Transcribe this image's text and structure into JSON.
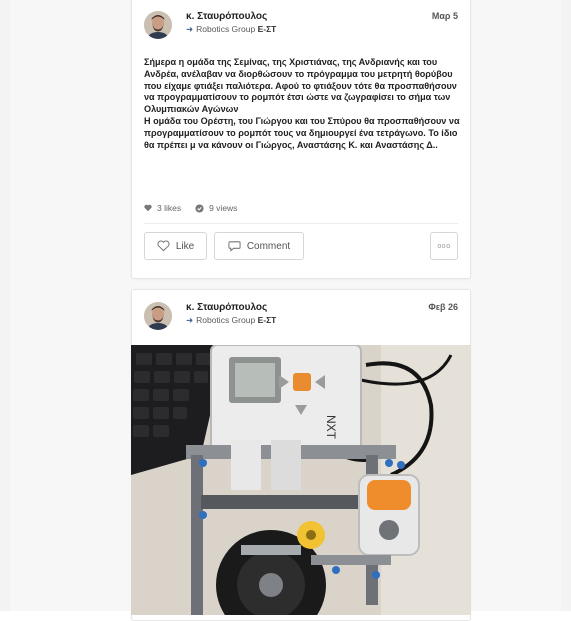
{
  "posts": [
    {
      "author": "κ. Σταυρόπουλος",
      "group": "Robotics Group",
      "group_suffix": "Ε-ΣΤ",
      "date": "Μαρ 5",
      "paragraphs": [
        "Σήμερα η ομάδα της Σεμίνας, της Χριστιάνας, της Ανδριανής και του Ανδρέα, ανέλαβαν να διορθώσουν το πρόγραμμα του μετρητή θορύβου που είχαμε φτιάξει παλιότερα. Αφού το φτιάξουν τότε θα προσπαθήσουν να προγραμματίσουν το ρομπότ έτσι ώστε να ζωγραφίσει το σήμα των Ολυμπιακών Αγώνων",
        "Η ομάδα του Ορέστη, του Γιώργου και του Σπύρου θα προσπαθήσουν να προγραμματίσουν το ρομπότ τους να δημιουργεί ένα τετράγωνο. Το ίδιο θα πρέπει μ να κάνουν οι Γιώργος, Αναστάσης Κ. και Αναστάσης Δ.."
      ],
      "likes": "3 likes",
      "views": "9 views",
      "like_label": "Like",
      "comment_label": "Comment",
      "more_label": "ooo"
    },
    {
      "author": "κ. Σταυρόπουλος",
      "group": "Robotics Group",
      "group_suffix": "Ε-ΣΤ",
      "date": "Φεβ 26",
      "brick_label": "NXT"
    }
  ],
  "icons": {
    "group_arrow": "arrow-right-icon",
    "likes": "heart-icon",
    "views": "eye-check-icon",
    "like_button": "heart-outline-icon",
    "comment_button": "speech-bubble-icon",
    "more": "more-dots-icon"
  },
  "colors": {
    "background": "#f3f3f3",
    "card": "#ffffff",
    "text": "#222222",
    "muted": "#666666",
    "border": "#d6d6d6"
  }
}
